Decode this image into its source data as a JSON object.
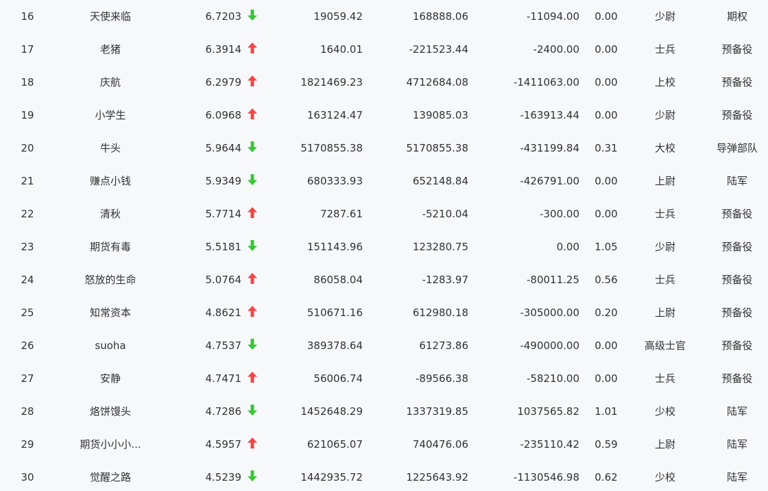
{
  "colors": {
    "up": "#f04848",
    "down": "#3cc43c"
  },
  "rows": [
    {
      "rank": "16",
      "name": "天使来临",
      "score": "6.7203",
      "trend": "down",
      "v1": "19059.42",
      "v2": "168888.06",
      "v3": "-11094.00",
      "ratio": "0.00",
      "title": "少尉",
      "unit": "期权"
    },
    {
      "rank": "17",
      "name": "老猪",
      "score": "6.3914",
      "trend": "up",
      "v1": "1640.01",
      "v2": "-221523.44",
      "v3": "-2400.00",
      "ratio": "0.00",
      "title": "士兵",
      "unit": "预备役"
    },
    {
      "rank": "18",
      "name": "庆航",
      "score": "6.2979",
      "trend": "up",
      "v1": "1821469.23",
      "v2": "4712684.08",
      "v3": "-1411063.00",
      "ratio": "0.00",
      "title": "上校",
      "unit": "预备役"
    },
    {
      "rank": "19",
      "name": "小学生",
      "score": "6.0968",
      "trend": "up",
      "v1": "163124.47",
      "v2": "139085.03",
      "v3": "-163913.44",
      "ratio": "0.00",
      "title": "少尉",
      "unit": "预备役"
    },
    {
      "rank": "20",
      "name": "牛头",
      "score": "5.9644",
      "trend": "down",
      "v1": "5170855.38",
      "v2": "5170855.38",
      "v3": "-431199.84",
      "ratio": "0.31",
      "title": "大校",
      "unit": "导弹部队"
    },
    {
      "rank": "21",
      "name": "赚点小钱",
      "score": "5.9349",
      "trend": "down",
      "v1": "680333.93",
      "v2": "652148.84",
      "v3": "-426791.00",
      "ratio": "0.00",
      "title": "上尉",
      "unit": "陆军"
    },
    {
      "rank": "22",
      "name": "清秋",
      "score": "5.7714",
      "trend": "up",
      "v1": "7287.61",
      "v2": "-5210.04",
      "v3": "-300.00",
      "ratio": "0.00",
      "title": "士兵",
      "unit": "预备役"
    },
    {
      "rank": "23",
      "name": "期货有毒",
      "score": "5.5181",
      "trend": "down",
      "v1": "151143.96",
      "v2": "123280.75",
      "v3": "0.00",
      "ratio": "1.05",
      "title": "少尉",
      "unit": "预备役"
    },
    {
      "rank": "24",
      "name": "怒放的生命",
      "score": "5.0764",
      "trend": "up",
      "v1": "86058.04",
      "v2": "-1283.97",
      "v3": "-80011.25",
      "ratio": "0.56",
      "title": "士兵",
      "unit": "预备役"
    },
    {
      "rank": "25",
      "name": "知常资本",
      "score": "4.8621",
      "trend": "up",
      "v1": "510671.16",
      "v2": "612980.18",
      "v3": "-305000.00",
      "ratio": "0.20",
      "title": "上尉",
      "unit": "预备役"
    },
    {
      "rank": "26",
      "name": "suoha",
      "score": "4.7537",
      "trend": "down",
      "v1": "389378.64",
      "v2": "61273.86",
      "v3": "-490000.00",
      "ratio": "0.00",
      "title": "高级士官",
      "unit": "预备役"
    },
    {
      "rank": "27",
      "name": "安静",
      "score": "4.7471",
      "trend": "up",
      "v1": "56006.74",
      "v2": "-89566.38",
      "v3": "-58210.00",
      "ratio": "0.00",
      "title": "士兵",
      "unit": "预备役"
    },
    {
      "rank": "28",
      "name": "烙饼馒头",
      "score": "4.7286",
      "trend": "down",
      "v1": "1452648.29",
      "v2": "1337319.85",
      "v3": "1037565.82",
      "ratio": "1.01",
      "title": "少校",
      "unit": "陆军"
    },
    {
      "rank": "29",
      "name": "期货小小小...",
      "score": "4.5957",
      "trend": "up",
      "v1": "621065.07",
      "v2": "740476.06",
      "v3": "-235110.42",
      "ratio": "0.59",
      "title": "上尉",
      "unit": "陆军"
    },
    {
      "rank": "30",
      "name": "觉醒之路",
      "score": "4.5239",
      "trend": "down",
      "v1": "1442935.72",
      "v2": "1225643.92",
      "v3": "-1130546.98",
      "ratio": "0.62",
      "title": "少校",
      "unit": "陆军"
    }
  ]
}
